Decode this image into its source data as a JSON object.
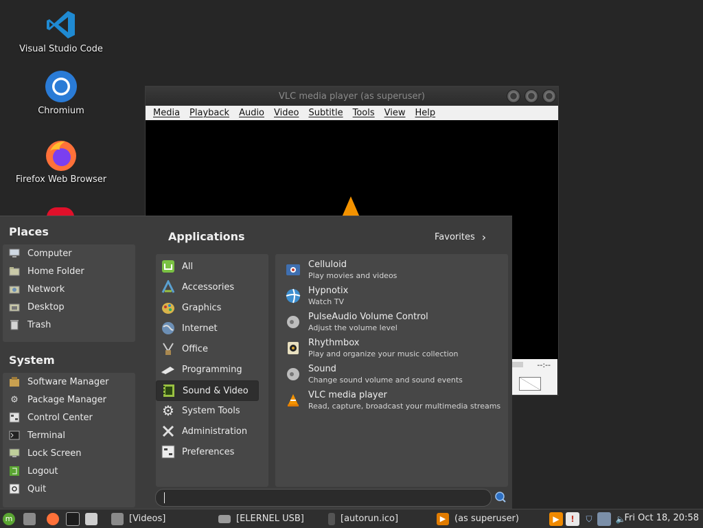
{
  "desktop": {
    "icons": [
      {
        "label": "Visual Studio Code",
        "icon": "vscode-icon"
      },
      {
        "label": "Chromium",
        "icon": "chromium-icon"
      },
      {
        "label": "Firefox Web Browser",
        "icon": "firefox-icon"
      }
    ]
  },
  "vlc": {
    "title": "VLC media player (as superuser)",
    "menus": [
      "Media",
      "Playback",
      "Audio",
      "Video",
      "Subtitle",
      "Tools",
      "View",
      "Help"
    ],
    "time": "--:--"
  },
  "menu": {
    "places_title": "Places",
    "places": [
      {
        "label": "Computer",
        "icon": "computer-icon"
      },
      {
        "label": "Home Folder",
        "icon": "home-folder-icon"
      },
      {
        "label": "Network",
        "icon": "network-icon"
      },
      {
        "label": "Desktop",
        "icon": "desktop-icon"
      },
      {
        "label": "Trash",
        "icon": "trash-icon"
      }
    ],
    "system_title": "System",
    "system": [
      {
        "label": "Software Manager",
        "icon": "software-manager-icon"
      },
      {
        "label": "Package Manager",
        "icon": "package-manager-icon"
      },
      {
        "label": "Control Center",
        "icon": "control-center-icon"
      },
      {
        "label": "Terminal",
        "icon": "terminal-icon"
      },
      {
        "label": "Lock Screen",
        "icon": "lock-screen-icon"
      },
      {
        "label": "Logout",
        "icon": "logout-icon"
      },
      {
        "label": "Quit",
        "icon": "quit-icon"
      }
    ],
    "applications_title": "Applications",
    "favorites_label": "Favorites",
    "categories": [
      {
        "label": "All",
        "icon": "mint-icon"
      },
      {
        "label": "Accessories",
        "icon": "accessories-icon"
      },
      {
        "label": "Graphics",
        "icon": "graphics-icon"
      },
      {
        "label": "Internet",
        "icon": "internet-icon"
      },
      {
        "label": "Office",
        "icon": "office-icon"
      },
      {
        "label": "Programming",
        "icon": "programming-icon"
      },
      {
        "label": "Sound & Video",
        "icon": "sound-video-icon",
        "selected": true
      },
      {
        "label": "System Tools",
        "icon": "system-tools-icon"
      },
      {
        "label": "Administration",
        "icon": "administration-icon"
      },
      {
        "label": "Preferences",
        "icon": "preferences-icon"
      }
    ],
    "apps": [
      {
        "name": "Celluloid",
        "desc": "Play movies and videos",
        "icon": "celluloid-icon"
      },
      {
        "name": "Hypnotix",
        "desc": "Watch TV",
        "icon": "hypnotix-icon"
      },
      {
        "name": "PulseAudio Volume Control",
        "desc": "Adjust the volume level",
        "icon": "speaker-icon"
      },
      {
        "name": "Rhythmbox",
        "desc": "Play and organize your music collection",
        "icon": "rhythmbox-icon"
      },
      {
        "name": "Sound",
        "desc": "Change sound volume and sound events",
        "icon": "speaker-icon"
      },
      {
        "name": "VLC media player",
        "desc": "Read, capture, broadcast your multimedia streams",
        "icon": "vlc-icon"
      }
    ],
    "search_value": ""
  },
  "taskbar": {
    "windows": [
      {
        "label": "[Videos]",
        "icon": "folder-icon"
      },
      {
        "label": "[ELERNEL USB]",
        "icon": "drive-icon"
      },
      {
        "label": "[autorun.ico]",
        "icon": "image-viewer-icon"
      },
      {
        "label": "(as superuser)",
        "icon": "vlc-icon"
      }
    ],
    "clock": "Fri Oct 18, 20:58"
  }
}
